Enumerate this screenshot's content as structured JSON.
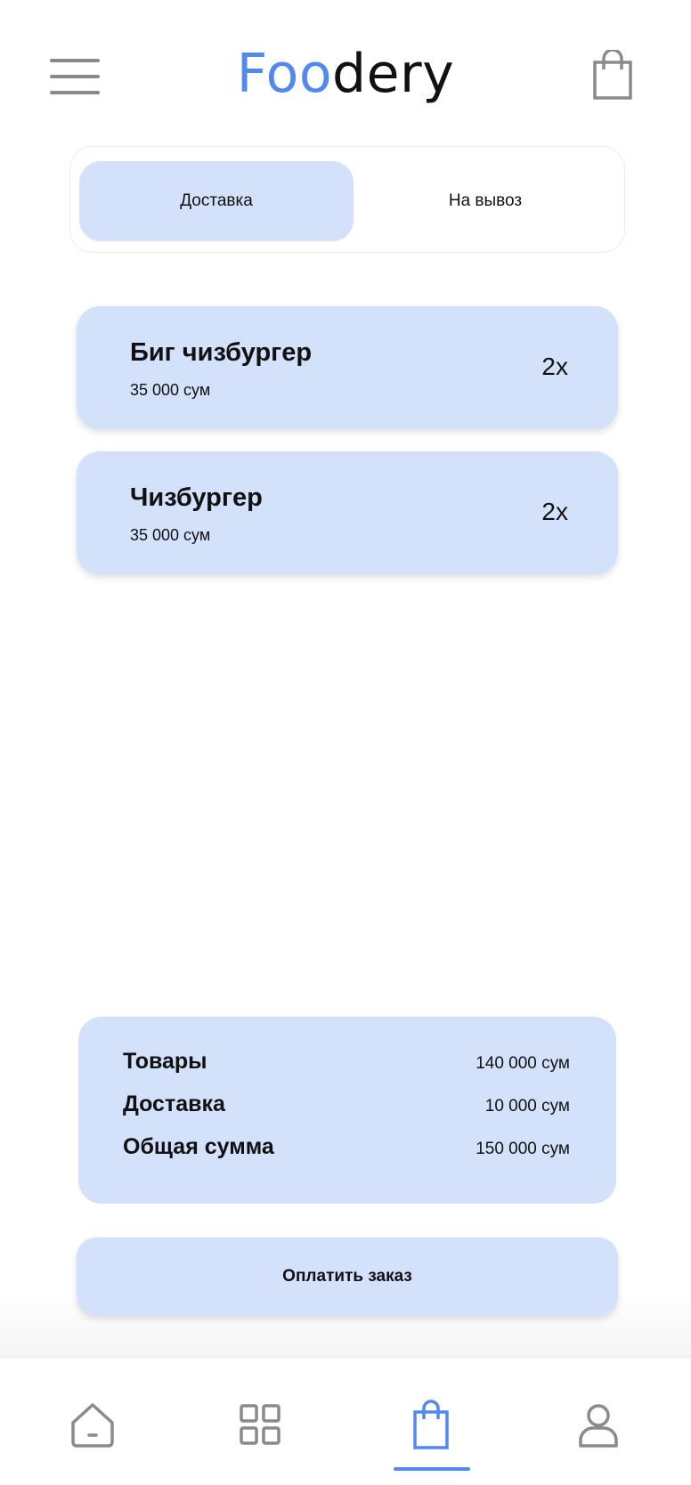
{
  "header": {
    "logo_part1": "Foo",
    "logo_part2": "dery",
    "menu_icon": "hamburger-icon",
    "cart_icon": "shopping-bag-icon"
  },
  "delivery_switch": {
    "options": [
      {
        "label": "Доставка",
        "selected": true
      },
      {
        "label": "На вывоз",
        "selected": false
      }
    ]
  },
  "cart": {
    "items": [
      {
        "name": "Биг чизбургер",
        "price": "35 000 сум",
        "quantity": "2x"
      },
      {
        "name": "Чизбургер",
        "price": "35 000 сум",
        "quantity": "2x"
      }
    ]
  },
  "summary": {
    "rows": [
      {
        "label": "Товары",
        "value": "140 000 сум"
      },
      {
        "label": "Доставка",
        "value": "10 000 сум"
      },
      {
        "label": "Общая сумма",
        "value": "150 000 сум"
      }
    ]
  },
  "pay_button": {
    "label": "Оплатить заказ"
  },
  "bottom_nav": {
    "items": [
      {
        "icon": "home-icon",
        "active": false
      },
      {
        "icon": "grid-icon",
        "active": false
      },
      {
        "icon": "shopping-bag-icon",
        "active": true
      },
      {
        "icon": "user-icon",
        "active": false
      }
    ]
  },
  "colors": {
    "accent": "#5189ee",
    "card_background": "#d4e1fb",
    "icon_gray": "#8a8a8a",
    "text": "#111111"
  }
}
